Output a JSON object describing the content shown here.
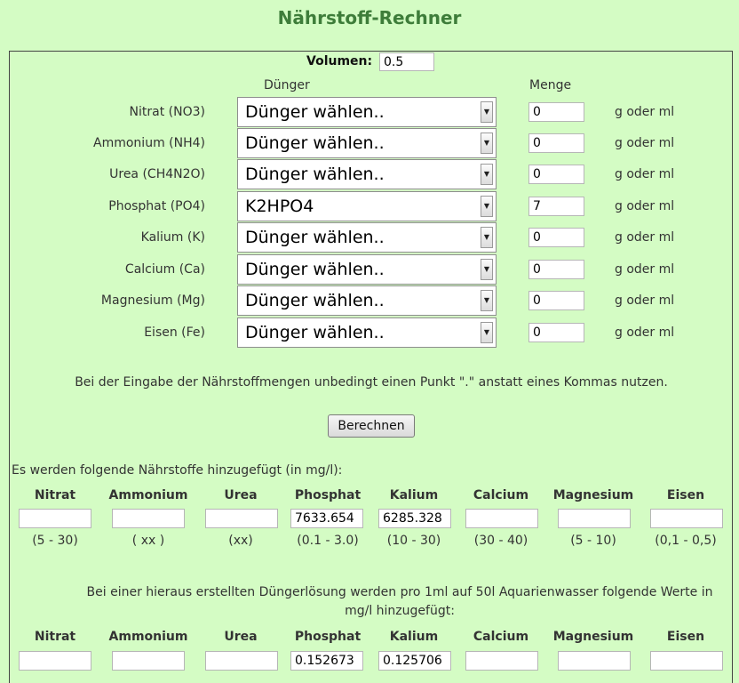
{
  "title": "Nährstoff-Rechner",
  "volume": {
    "label": "Volumen:",
    "value": "0.5"
  },
  "headers": {
    "fertilizer": "Dünger",
    "amount": "Menge"
  },
  "nutrients": [
    {
      "label": "Nitrat (NO3)",
      "selected": "Dünger wählen..",
      "amount": "0",
      "unit": "g oder ml"
    },
    {
      "label": "Ammonium (NH4)",
      "selected": "Dünger wählen..",
      "amount": "0",
      "unit": "g oder ml"
    },
    {
      "label": "Urea (CH4N2O)",
      "selected": "Dünger wählen..",
      "amount": "0",
      "unit": "g oder ml"
    },
    {
      "label": "Phosphat (PO4)",
      "selected": "K2HPO4",
      "amount": "7",
      "unit": "g oder ml"
    },
    {
      "label": "Kalium (K)",
      "selected": "Dünger wählen..",
      "amount": "0",
      "unit": "g oder ml"
    },
    {
      "label": "Calcium (Ca)",
      "selected": "Dünger wählen..",
      "amount": "0",
      "unit": "g oder ml"
    },
    {
      "label": "Magnesium (Mg)",
      "selected": "Dünger wählen..",
      "amount": "0",
      "unit": "g oder ml"
    },
    {
      "label": "Eisen (Fe)",
      "selected": "Dünger wählen..",
      "amount": "0",
      "unit": "g oder ml"
    }
  ],
  "note": "Bei der Eingabe der Nährstoffmengen unbedingt einen Punkt \".\" anstatt eines Kommas nutzen.",
  "calculate_label": "Berechnen",
  "added_title": "Es werden folgende Nährstoffe hinzugefügt (in mg/l):",
  "added": [
    {
      "name": "Nitrat",
      "value": "",
      "range": "(5 - 30)"
    },
    {
      "name": "Ammonium",
      "value": "",
      "range": "( xx )"
    },
    {
      "name": "Urea",
      "value": "",
      "range": "(xx)"
    },
    {
      "name": "Phosphat",
      "value": "7633.654",
      "range": "(0.1 - 3.0)"
    },
    {
      "name": "Kalium",
      "value": "6285.328",
      "range": "(10 - 30)"
    },
    {
      "name": "Calcium",
      "value": "",
      "range": "(30 - 40)"
    },
    {
      "name": "Magnesium",
      "value": "",
      "range": "(5 - 10)"
    },
    {
      "name": "Eisen",
      "value": "",
      "range": "(0,1 - 0,5)"
    }
  ],
  "solution_note": "Bei einer hieraus erstellten Düngerlösung werden pro 1ml auf 50l Aquarienwasser folgende Werte in mg/l hinzugefügt:",
  "solution": [
    {
      "name": "Nitrat",
      "value": ""
    },
    {
      "name": "Ammonium",
      "value": ""
    },
    {
      "name": "Urea",
      "value": ""
    },
    {
      "name": "Phosphat",
      "value": "0.152673"
    },
    {
      "name": "Kalium",
      "value": "0.125706"
    },
    {
      "name": "Calcium",
      "value": ""
    },
    {
      "name": "Magnesium",
      "value": ""
    },
    {
      "name": "Eisen",
      "value": ""
    }
  ]
}
